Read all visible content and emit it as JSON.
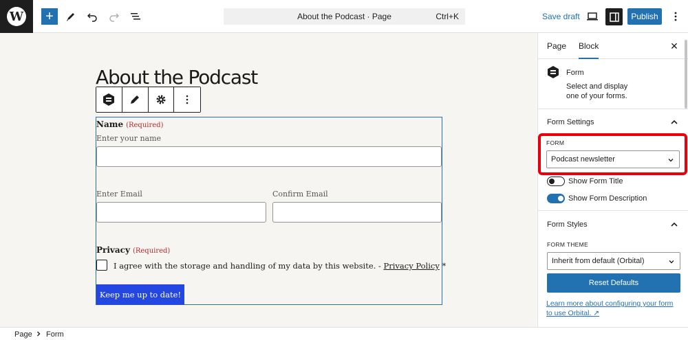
{
  "topbar": {
    "document_title": "About the Podcast · Page",
    "shortcut": "Ctrl+K",
    "save_draft_label": "Save draft",
    "publish_label": "Publish",
    "add_symbol": "+"
  },
  "canvas": {
    "page_title": "About the Podcast",
    "form": {
      "name_label": "Name",
      "name_required": "(Required)",
      "name_placeholder": "Enter your name",
      "email_label": "Enter Email",
      "confirm_email_label": "Confirm Email",
      "privacy_label": "Privacy",
      "privacy_required": "(Required)",
      "consent_text": "I agree with the storage and handling of my data by this website. - ",
      "privacy_link": "Privacy Policy",
      "consent_asterisk": " *",
      "submit_label": "Keep me up to date!"
    }
  },
  "sidebar": {
    "tabs": [
      {
        "label": "Page",
        "active": false
      },
      {
        "label": "Block",
        "active": true
      }
    ],
    "close_symbol": "✕",
    "block": {
      "name": "Form",
      "description": "Select and display one of your forms."
    },
    "form_settings": {
      "title": "Form Settings",
      "form_field_label": "FORM",
      "form_selected": "Podcast newsletter",
      "show_title_label": "Show Form Title",
      "show_title_on": false,
      "show_description_label": "Show Form Description",
      "show_description_on": true
    },
    "form_styles": {
      "title": "Form Styles",
      "theme_label": "FORM THEME",
      "theme_selected": "Inherit from default (Orbital)",
      "reset_label": "Reset Defaults",
      "learn_link": "Learn more about configuring your form to use Orbital. ↗"
    }
  },
  "breadcrumb": [
    "Page",
    "Form"
  ],
  "colors": {
    "accent": "#2271b1",
    "highlight": "#e8000b",
    "required": "#b32d2e",
    "submit": "#2347e0"
  }
}
